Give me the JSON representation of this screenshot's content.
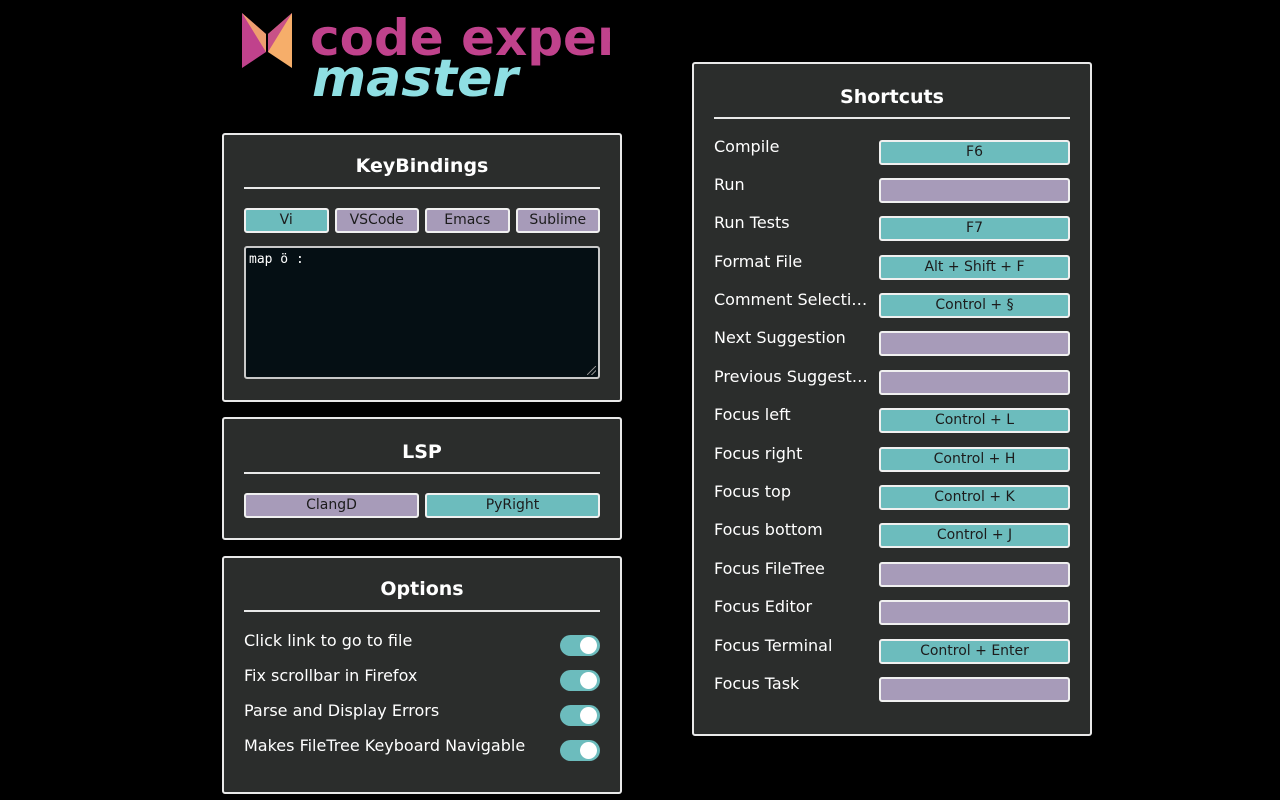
{
  "logo": {
    "top_text": "code expert",
    "bottom_text": "master"
  },
  "keybindings": {
    "title": "KeyBindings",
    "options": [
      {
        "label": "Vi",
        "active": true
      },
      {
        "label": "VSCode",
        "active": false
      },
      {
        "label": "Emacs",
        "active": false
      },
      {
        "label": "Sublime",
        "active": false
      }
    ],
    "editor_text": "map ö :"
  },
  "lsp": {
    "title": "LSP",
    "options": [
      {
        "label": "ClangD",
        "active": false
      },
      {
        "label": "PyRight",
        "active": true
      }
    ]
  },
  "options": {
    "title": "Options",
    "items": [
      {
        "label": "Click link to go to file",
        "enabled": true
      },
      {
        "label": "Fix scrollbar in Firefox",
        "enabled": true
      },
      {
        "label": "Parse and Display Errors",
        "enabled": true
      },
      {
        "label": "Makes FileTree Keyboard Navigable",
        "enabled": true
      }
    ]
  },
  "shortcuts": {
    "title": "Shortcuts",
    "items": [
      {
        "label": "Compile",
        "key": "F6"
      },
      {
        "label": "Run",
        "key": ""
      },
      {
        "label": "Run Tests",
        "key": "F7"
      },
      {
        "label": "Format File",
        "key": "Alt + Shift + F"
      },
      {
        "label": "Comment Selection",
        "key": "Control + §"
      },
      {
        "label": "Next Suggestion",
        "key": ""
      },
      {
        "label": "Previous Suggestion",
        "key": ""
      },
      {
        "label": "Focus left",
        "key": "Control + L"
      },
      {
        "label": "Focus right",
        "key": "Control + H"
      },
      {
        "label": "Focus top",
        "key": "Control + K"
      },
      {
        "label": "Focus bottom",
        "key": "Control + J"
      },
      {
        "label": "Focus FileTree",
        "key": ""
      },
      {
        "label": "Focus Editor",
        "key": ""
      },
      {
        "label": "Focus Terminal",
        "key": "Control + Enter"
      },
      {
        "label": "Focus Task",
        "key": ""
      }
    ]
  },
  "colors": {
    "background": "#000000",
    "panel": "#2b2d2c",
    "active": "#6cbcbd",
    "inactive": "#a79bb9",
    "logo_pink": "#c0428c",
    "logo_orange": "#f6ae6a",
    "logo_cyan": "#8fdfe3"
  }
}
